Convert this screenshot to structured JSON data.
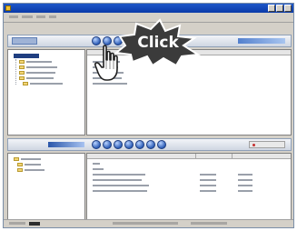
{
  "callout": {
    "label": "Click"
  },
  "colors": {
    "titlebar": "#0a3aa8",
    "window_bg": "#d4d0c8",
    "accent_buttons": "#2f5fb8",
    "callout_fill": "#3b3b3b",
    "callout_text": "#ffffff"
  },
  "icons": {
    "app": "app-icon",
    "pointer": "hand-pointer-icon",
    "minimize": "minimize-icon",
    "maximize": "maximize-icon",
    "close": "close-icon"
  }
}
